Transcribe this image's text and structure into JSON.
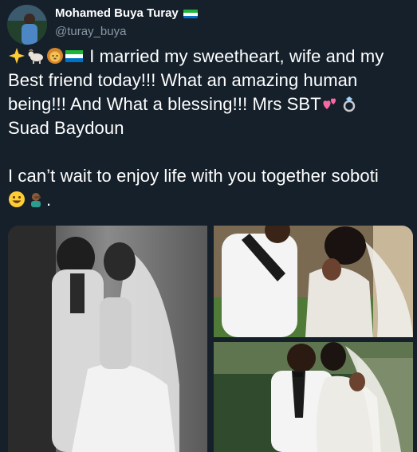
{
  "account": {
    "display_name": "Mohamed Buya Turay",
    "handle": "@turay_buya",
    "avatar_icon": "avatar-photo",
    "flag_icon": "sierra-leone-flag-icon"
  },
  "tweet": {
    "line1": "I married my sweetheart, wife and my",
    "line2": "Best friend today!!! What an amazing human",
    "line3": "being!!! And What a blessing!!! Mrs SBT",
    "line4": "Suad Baydoun",
    "line5": "I can’t wait to enjoy life with you together soboti",
    "line6_suffix": ".",
    "emojis": [
      "sparkle-star-icon",
      "goat-icon",
      "lion-icon",
      "sierra-leone-flag-icon",
      "revolving-hearts-icon",
      "ring-icon",
      "smiley-icon",
      "person-facepalming-icon"
    ]
  },
  "media": {
    "photos": [
      "wedding-photo-bw",
      "wedding-photo-top-right",
      "wedding-photo-bottom-right"
    ]
  },
  "colors": {
    "background": "#15202b",
    "secondary_text": "#8b98a5",
    "flag_green": "#1eb53a",
    "flag_white": "#ffffff",
    "flag_blue": "#0072c6"
  }
}
